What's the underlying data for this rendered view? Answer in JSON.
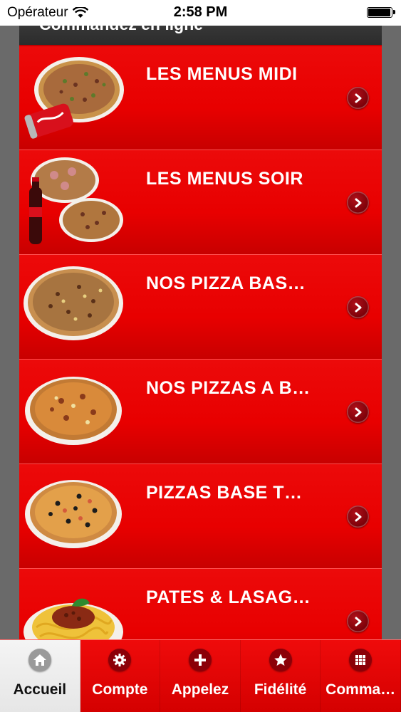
{
  "status_bar": {
    "carrier": "Opérateur",
    "time": "2:58 PM"
  },
  "nav": {
    "title": "Commandez en ligne"
  },
  "menu": {
    "items": [
      {
        "label": "LES MENUS MIDI",
        "icon": "pizza-and-soda-can-thumbnail"
      },
      {
        "label": "LES MENUS SOIR",
        "icon": "two-pizzas-and-soda-bottle-thumbnail"
      },
      {
        "label": "NOS PIZZA BAS…",
        "icon": "pizza-thumbnail"
      },
      {
        "label": "NOS PIZZAS A B…",
        "icon": "pizza-thumbnail"
      },
      {
        "label": "PIZZAS BASE T…",
        "icon": "pizza-with-olives-thumbnail"
      },
      {
        "label": "PATES & LASAG…",
        "icon": "pasta-thumbnail"
      }
    ]
  },
  "tab_bar": {
    "tabs": [
      {
        "label": "Accueil",
        "icon": "home-icon",
        "active": true
      },
      {
        "label": "Compte",
        "icon": "gear-icon",
        "active": false
      },
      {
        "label": "Appelez",
        "icon": "plus-icon",
        "active": false
      },
      {
        "label": "Fidélité",
        "icon": "star-icon",
        "active": false
      },
      {
        "label": "Comma…",
        "icon": "grid-icon",
        "active": false
      }
    ]
  },
  "colors": {
    "accent_red": "#e80000",
    "nav_dark": "#333333",
    "chevron_bg": "#8b0008"
  }
}
